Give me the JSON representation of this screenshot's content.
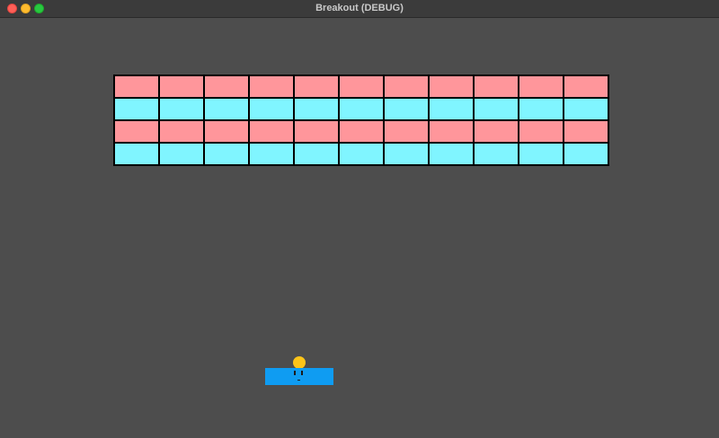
{
  "window": {
    "title": "Breakout (DEBUG)"
  },
  "colors": {
    "background": "#4d4d4d",
    "brick_red": "#ff969b",
    "brick_cyan": "#80f5ff",
    "brick_border": "#000000",
    "paddle": "#0f9cf2",
    "ball": "#fcc419"
  },
  "bricks": {
    "rows": [
      "red",
      "cyan",
      "red",
      "cyan"
    ],
    "columns": 11
  },
  "icons": {
    "close": "close-icon",
    "minimize": "minimize-icon",
    "maximize": "maximize-icon"
  }
}
